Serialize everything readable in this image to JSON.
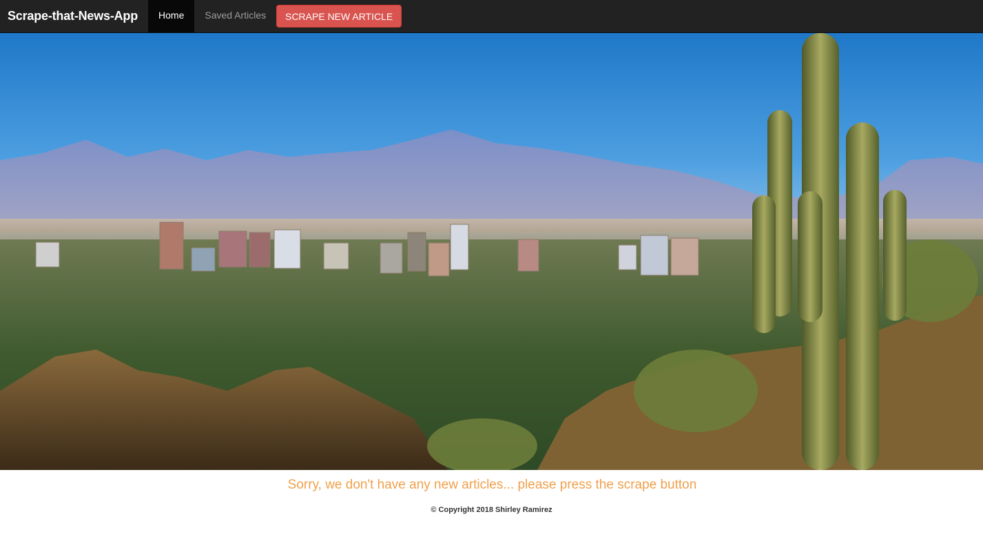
{
  "navbar": {
    "brand": "Scrape-that-News-App",
    "links": [
      {
        "label": "Home",
        "active": true
      },
      {
        "label": "Saved Articles",
        "active": false
      }
    ],
    "scrape_button": "SCRAPE NEW ARTICLE"
  },
  "hero": {
    "image": "desert-city-skyline-with-saguaro-cactus"
  },
  "main": {
    "empty_message": "Sorry, we don't have any new articles... please press the scrape button"
  },
  "footer": {
    "copyright": "© Copyright 2018 Shirley Ramirez"
  },
  "colors": {
    "navbar_bg": "#222222",
    "active_tab_bg": "#080808",
    "scrape_button": "#d9534f",
    "message": "#f0a04b"
  }
}
